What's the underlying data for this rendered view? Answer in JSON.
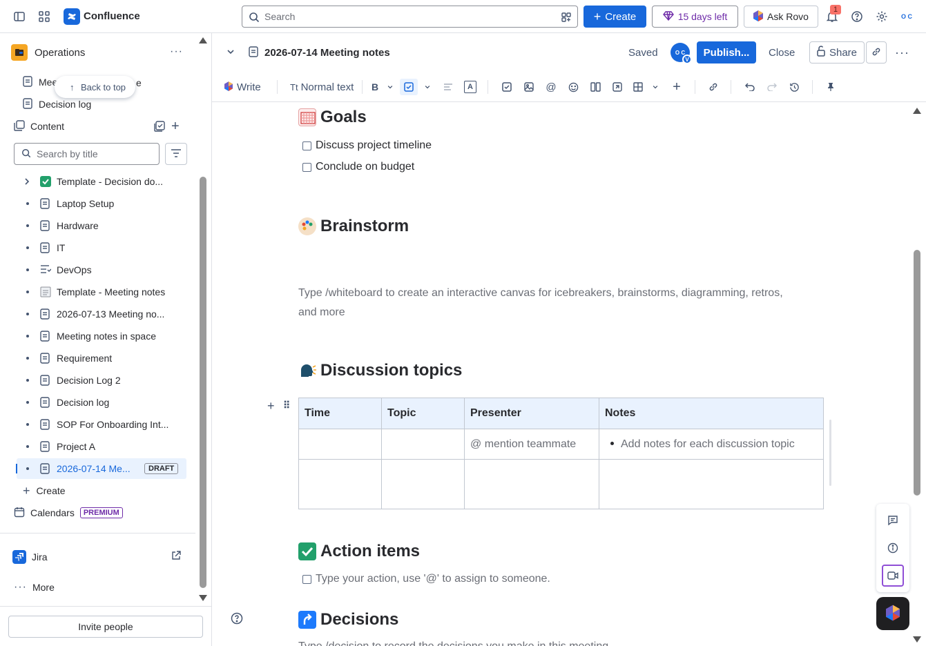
{
  "topbar": {
    "brand": "Confluence",
    "search_placeholder": "Search",
    "create_label": "Create",
    "trial_label": "15 days left",
    "rovo_label": "Ask Rovo",
    "notifications_count": "1",
    "avatar_text": "O C"
  },
  "sidebar": {
    "space_name": "Operations",
    "back_to_top": "Back to top",
    "pinned": [
      "Meeting notes in space",
      "Decision log"
    ],
    "content_label": "Content",
    "search_placeholder": "Search by title",
    "tree": [
      {
        "label": "Template - Decision do...",
        "icon": "check-emoji-icon",
        "expand": true
      },
      {
        "label": "Laptop Setup",
        "icon": "page-icon"
      },
      {
        "label": "Hardware",
        "icon": "page-icon"
      },
      {
        "label": "IT",
        "icon": "page-icon"
      },
      {
        "label": "DevOps",
        "icon": "list-page-icon"
      },
      {
        "label": "Template - Meeting notes",
        "icon": "notepad-emoji-icon"
      },
      {
        "label": "2026-07-13 Meeting no...",
        "icon": "page-icon"
      },
      {
        "label": "Meeting notes in space",
        "icon": "page-icon"
      },
      {
        "label": "Requirement",
        "icon": "page-icon"
      },
      {
        "label": "Decision Log 2",
        "icon": "page-icon"
      },
      {
        "label": "Decision log",
        "icon": "page-icon"
      },
      {
        "label": "SOP For Onboarding Int...",
        "icon": "page-icon"
      },
      {
        "label": "Project A",
        "icon": "page-icon"
      },
      {
        "label": "2026-07-14 Me...",
        "icon": "page-icon",
        "active": true,
        "badge": "DRAFT"
      }
    ],
    "create_label": "Create",
    "calendars_label": "Calendars",
    "premium_badge": "PREMIUM",
    "jira_label": "Jira",
    "more_label": "More",
    "invite_label": "Invite people"
  },
  "page_header": {
    "title": "2026-07-14 Meeting notes",
    "status": "Saved",
    "avatar_text": "O C",
    "avatar_badge": "V",
    "publish_label": "Publish...",
    "close_label": "Close",
    "share_label": "Share"
  },
  "toolbar": {
    "write_label": "Write",
    "text_style": "Normal text"
  },
  "content": {
    "goals_heading": "Goals",
    "goals": [
      "Discuss project timeline",
      "Conclude on budget"
    ],
    "brainstorm_heading": "Brainstorm",
    "brainstorm_hint_1": "Type /whiteboard to create an interactive canvas for icebreakers, brainstorms, diagramming, retros,",
    "brainstorm_hint_2": "and more",
    "discussion_heading": "Discussion topics",
    "table_headers": [
      "Time",
      "Topic",
      "Presenter",
      "Notes"
    ],
    "table_row1_presenter": "@ mention teammate",
    "table_row1_notes": "Add notes for each discussion topic",
    "action_heading": "Action items",
    "action_placeholder": "Type your action, use '@' to assign to someone.",
    "decisions_heading": "Decisions",
    "decisions_hint": "Type /decision to record the decisions you make in this meeting."
  },
  "colors": {
    "brand": "#1868db",
    "trial": "#6e2ba8",
    "active_bg": "#e9f2fe"
  }
}
